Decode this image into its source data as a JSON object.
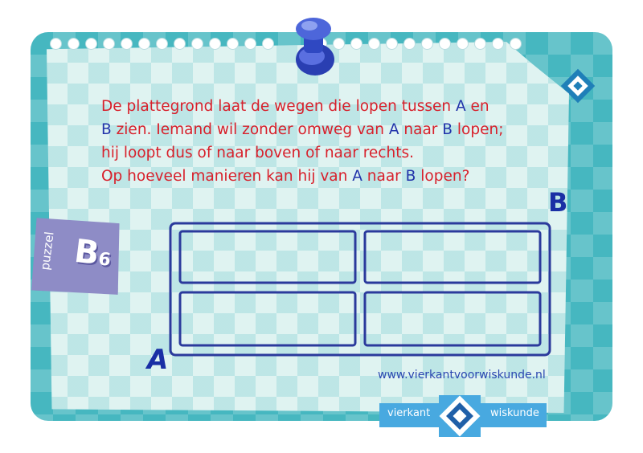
{
  "question": {
    "line1_a": "De plattegrond laat de wegen die lopen tussen ",
    "line1_A": "A",
    "line1_b": " en",
    "line2_B": "B",
    "line2_a": " zien. Iemand wil zonder omweg van ",
    "line2_A": "A",
    "line2_b": " naar ",
    "line2_B2": "B",
    "line2_c": " lopen;",
    "line3": "hij loopt dus of naar boven of naar rechts.",
    "line4_a": "Op hoeveel manieren kan hij van ",
    "line4_A": "A",
    "line4_b": " naar ",
    "line4_B": "B",
    "line4_c": " lopen?"
  },
  "diagram": {
    "start_label": "A",
    "end_label": "B"
  },
  "tag": {
    "word": "puzzel",
    "letter": "B",
    "number": "6"
  },
  "footer": {
    "url": "www.vierkantvoorwiskunde.nl",
    "brand_left": "vierkant",
    "brand_right": "wiskunde"
  },
  "colors": {
    "question_text": "#d8202b",
    "point_labels": "#2233aa",
    "roads": "#2b3a9c",
    "brand": "#48a9e0",
    "background": "#46b7c0"
  },
  "icons": {
    "pin": "pushpin-icon",
    "logo": "vierkant-logo-icon"
  }
}
